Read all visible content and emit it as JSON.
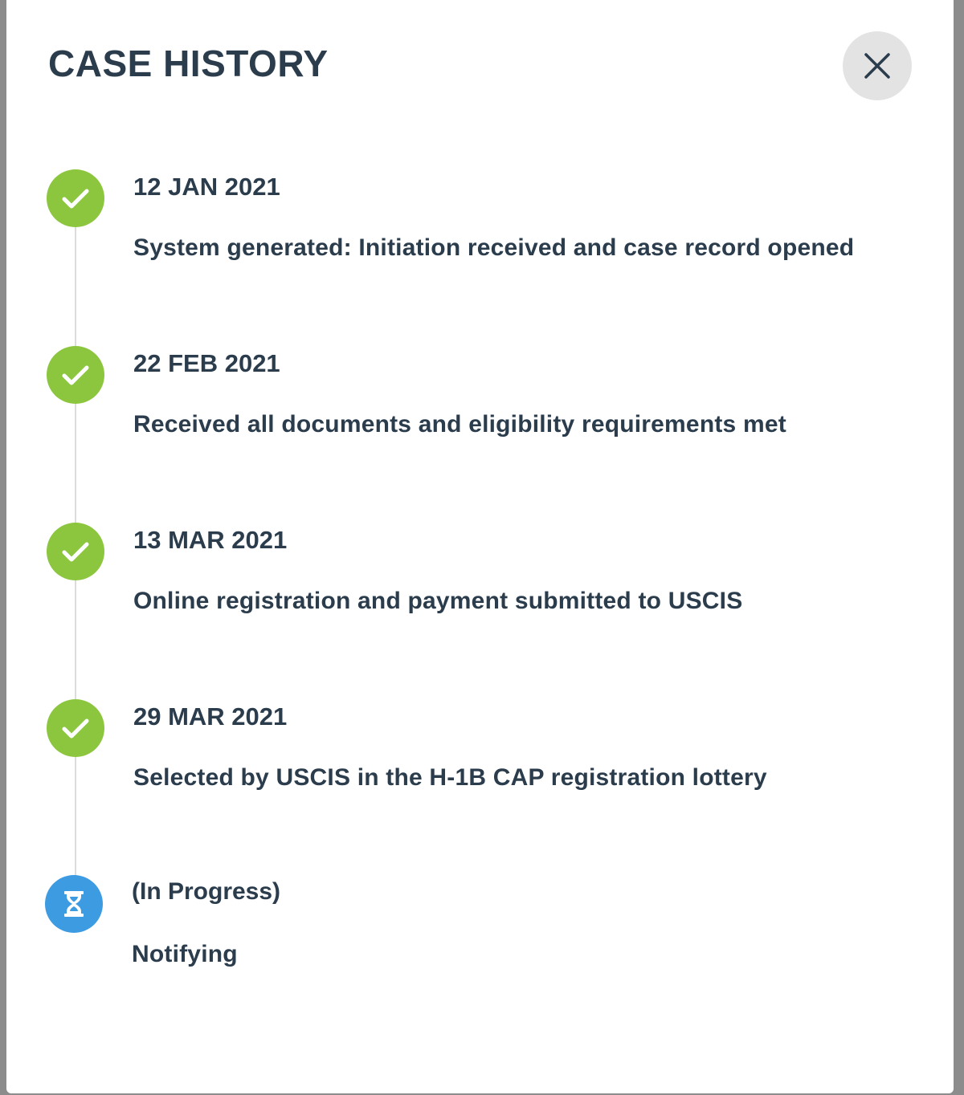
{
  "modal": {
    "title": "CASE HISTORY",
    "close_icon": "close-icon"
  },
  "colors": {
    "title_text": "#2b3c4c",
    "done_badge": "#8cc63f",
    "progress_badge": "#3d9be2",
    "timeline_line": "#dcdcdc",
    "close_button_bg": "#e3e3e3"
  },
  "timeline": {
    "steps": [
      {
        "status": "completed",
        "icon": "check-icon",
        "date": "12 JAN 2021",
        "description": "System generated: Initiation received and case record opened"
      },
      {
        "status": "completed",
        "icon": "check-icon",
        "date": "22 FEB 2021",
        "description": "Received all documents and eligibility requirements met"
      },
      {
        "status": "completed",
        "icon": "check-icon",
        "date": "13 MAR 2021",
        "description": "Online registration and payment submitted to USCIS"
      },
      {
        "status": "completed",
        "icon": "check-icon",
        "date": "29 MAR 2021",
        "description": "Selected by USCIS in the H-1B CAP registration lottery"
      },
      {
        "status": "in-progress",
        "icon": "hourglass-icon",
        "date": "(In Progress)",
        "description": "Notifying"
      }
    ]
  }
}
